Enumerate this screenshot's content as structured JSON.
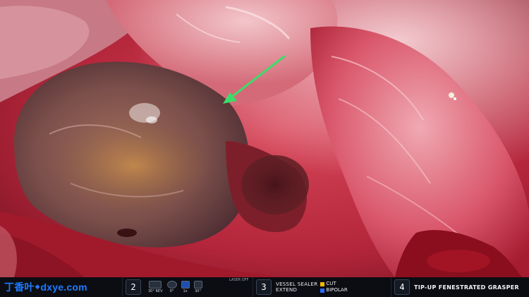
{
  "watermark": {
    "logo": "丁香叶",
    "domain": "dxye.com"
  },
  "hud": {
    "arm2": {
      "number": "2"
    },
    "camera": {
      "items": [
        {
          "icon": "scope-30-degree-icon",
          "label": "30° REV"
        },
        {
          "icon": "scope-0-degree-icon",
          "label": "0°"
        },
        {
          "icon": "zoom-icon",
          "label": "1x"
        },
        {
          "icon": "angle-icon",
          "label": "30°"
        }
      ],
      "laser_label": "LASER OFF"
    },
    "arm3": {
      "number": "3",
      "tool_line1": "VESSEL SEALER",
      "tool_line2": "EXTEND",
      "pedal_cut": "CUT",
      "pedal_bipolar": "BIPOLAR"
    },
    "arm4": {
      "number": "4",
      "tool": "TIP-UP FENESTRATED GRASPER"
    }
  },
  "colors": {
    "accent_blue": "#1e7bff",
    "cut_yellow": "#f5b800",
    "bipolar_blue": "#2b6cff",
    "hud_bg": "#0b0d12",
    "arrow_green": "#3ddc6a"
  },
  "annotation": {
    "arrow_icon": "green-arrow-icon"
  }
}
